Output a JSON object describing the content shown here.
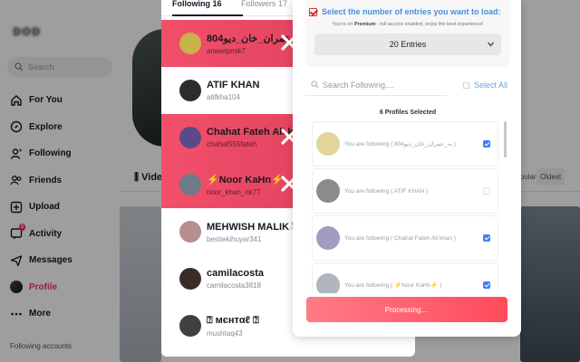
{
  "sidebar": {
    "logo": "ᴅᴏᴅ",
    "search_placeholder": "Search",
    "items": [
      {
        "label": "For You",
        "icon": "home-icon"
      },
      {
        "label": "Explore",
        "icon": "compass-icon"
      },
      {
        "label": "Following",
        "icon": "following-icon"
      },
      {
        "label": "Friends",
        "icon": "friends-icon"
      },
      {
        "label": "Upload",
        "icon": "upload-icon"
      },
      {
        "label": "Activity",
        "icon": "activity-icon",
        "badge": "3"
      },
      {
        "label": "Messages",
        "icon": "messages-icon"
      },
      {
        "label": "Profile",
        "icon": "avatar",
        "active": true
      },
      {
        "label": "More",
        "icon": "more-icon"
      }
    ],
    "footer": "Following accounts"
  },
  "background": {
    "videos_tab": "Videos",
    "sort_popular": "Popular",
    "sort_oldest": "Oldest"
  },
  "modal": {
    "tab_following": "Following 16",
    "tab_followers": "Followers 17",
    "users": [
      {
        "name": "804بہ_عمران_خان_دیو",
        "handle": "anwerpmik7",
        "selected": true,
        "avatar_color": "#c9b24a"
      },
      {
        "name": "ATIF KHAN",
        "handle": "atifkha104",
        "selected": false,
        "avatar_color": "#2c2c2c"
      },
      {
        "name": "Chahat Fateh Ali khan",
        "handle": "chahat555fateh",
        "selected": true,
        "avatar_color": "#5a4a8a"
      },
      {
        "name": "⚡Noor KaHn⚡",
        "handle": "noor_khan_nk77",
        "selected": true,
        "avatar_color": "#6e7a88"
      },
      {
        "name": "MEHWISH MALIK🦄",
        "handle": "bestiekihuyar341",
        "selected": false,
        "avatar_color": "#b88f8f"
      },
      {
        "name": "camilacosta",
        "handle": "camilacosta3818",
        "selected": false,
        "avatar_color": "#3b2c28"
      },
      {
        "name": "⍰ мєнтαℓ ⍰",
        "handle": "mushtaq43",
        "selected": false,
        "avatar_color": "#404040"
      }
    ]
  },
  "extension": {
    "title": "Select the number of entries you want to load:",
    "subtitle_prefix": "You're on ",
    "subtitle_plan": "Premium",
    "subtitle_suffix": " - full access enabled, enjoy the best experience!",
    "entries_value": "20 Entries",
    "search_placeholder": "Search Following....",
    "select_all": "Select All",
    "selected_count": "6 Profiles Selected",
    "items": [
      {
        "text": "You are following ( 804بہ_عمران_خان_دیو )",
        "checked": true,
        "avatar_color": "#c9b24a"
      },
      {
        "text": "You are following ( ATIF KHAN )",
        "checked": false,
        "avatar_color": "#2c2c2c"
      },
      {
        "text": "You are following ( Chahat Fateh Ali khan )",
        "checked": true,
        "avatar_color": "#5a4a8a"
      },
      {
        "text": "You are following ( ⚡Noor KaHn⚡ )",
        "checked": true,
        "avatar_color": "#6e7a88"
      }
    ],
    "button": "Processing...."
  }
}
